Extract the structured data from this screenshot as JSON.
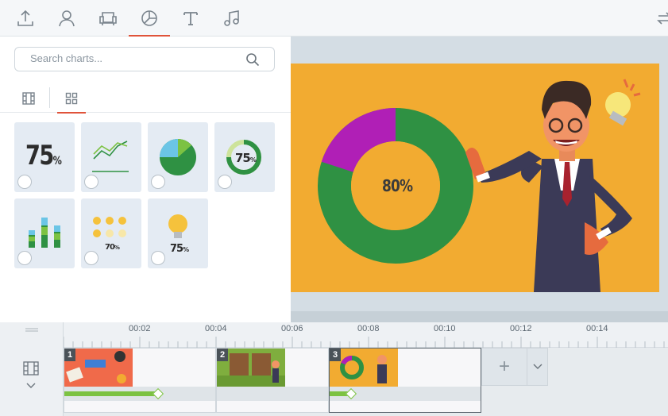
{
  "toolbar": {
    "tools": [
      {
        "name": "upload-icon",
        "active": false
      },
      {
        "name": "character-icon",
        "active": false
      },
      {
        "name": "props-icon",
        "active": false
      },
      {
        "name": "charts-icon",
        "active": true
      },
      {
        "name": "text-icon",
        "active": false
      },
      {
        "name": "music-icon",
        "active": false
      }
    ],
    "right_tool": "swap-icon",
    "accent": "#e0533a"
  },
  "panel": {
    "search_placeholder": "Search charts...",
    "subtabs": [
      {
        "name": "film-grid-icon",
        "active": false
      },
      {
        "name": "grid-icon",
        "active": true
      }
    ],
    "thumbnails": [
      {
        "kind": "number",
        "text": "75",
        "suffix": "%"
      },
      {
        "kind": "line-chart"
      },
      {
        "kind": "pie-chart"
      },
      {
        "kind": "donut",
        "text": "75",
        "suffix": "%"
      },
      {
        "kind": "bar-chart"
      },
      {
        "kind": "bulbs",
        "text": "70",
        "suffix": "%"
      },
      {
        "kind": "bulb",
        "text": "75",
        "suffix": "%"
      }
    ]
  },
  "slide": {
    "donut_label": "80%",
    "background": "#f2ab31",
    "donut_colors": {
      "main": "#2f9143",
      "secondary": "#b01fb6"
    },
    "donut_value": 0.8
  },
  "timeline": {
    "ticks": [
      "00:02",
      "00:04",
      "00:06",
      "00:08",
      "00:10",
      "00:12",
      "00:14"
    ],
    "clips": [
      {
        "number": "1",
        "selected": false,
        "thumb": "title-scene",
        "fill": 0.62
      },
      {
        "number": "2",
        "selected": false,
        "thumb": "store-scene",
        "fill": 0
      },
      {
        "number": "3",
        "selected": true,
        "thumb": "chart-scene",
        "fill": 0.14
      }
    ],
    "add_label": "+"
  }
}
